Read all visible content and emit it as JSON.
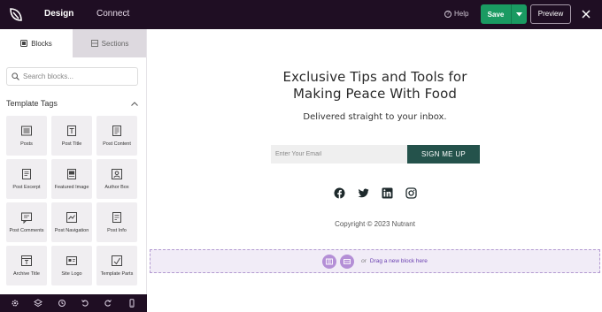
{
  "topbar": {
    "tabs": {
      "design": "Design",
      "connect": "Connect"
    },
    "help_label": "Help",
    "save_label": "Save",
    "preview_label": "Preview"
  },
  "sidebar": {
    "tabs": {
      "blocks": "Blocks",
      "sections": "Sections"
    },
    "search_placeholder": "Search blocks...",
    "group_title": "Template Tags",
    "blocks": [
      {
        "label": "Posts",
        "icon": "posts-icon"
      },
      {
        "label": "Post Title",
        "icon": "post-title-icon"
      },
      {
        "label": "Post Content",
        "icon": "post-content-icon"
      },
      {
        "label": "Post Excerpt",
        "icon": "post-excerpt-icon"
      },
      {
        "label": "Featured Image",
        "icon": "featured-image-icon"
      },
      {
        "label": "Author Box",
        "icon": "author-box-icon"
      },
      {
        "label": "Post Comments",
        "icon": "post-comments-icon"
      },
      {
        "label": "Post Navigation",
        "icon": "post-navigation-icon"
      },
      {
        "label": "Post Info",
        "icon": "post-info-icon"
      },
      {
        "label": "Archive Title",
        "icon": "archive-title-icon"
      },
      {
        "label": "Site Logo",
        "icon": "site-logo-icon"
      },
      {
        "label": "Template Parts",
        "icon": "template-parts-icon"
      }
    ]
  },
  "canvas": {
    "headline_line1": "Exclusive Tips and Tools for",
    "headline_line2": "Making Peace With Food",
    "subheadline": "Delivered straight to your inbox.",
    "email_placeholder": "Enter Your Email",
    "signup_label": "SIGN ME UP",
    "copyright": "Copyright © 2023 Nutrant",
    "dropzone": {
      "or": "or",
      "text": "Drag a new block here"
    }
  },
  "colors": {
    "topbar_bg": "#1f0e23",
    "save_green": "#1a9a62",
    "signup_bg": "#24524b",
    "dropzone_accent": "#b48fd6"
  }
}
